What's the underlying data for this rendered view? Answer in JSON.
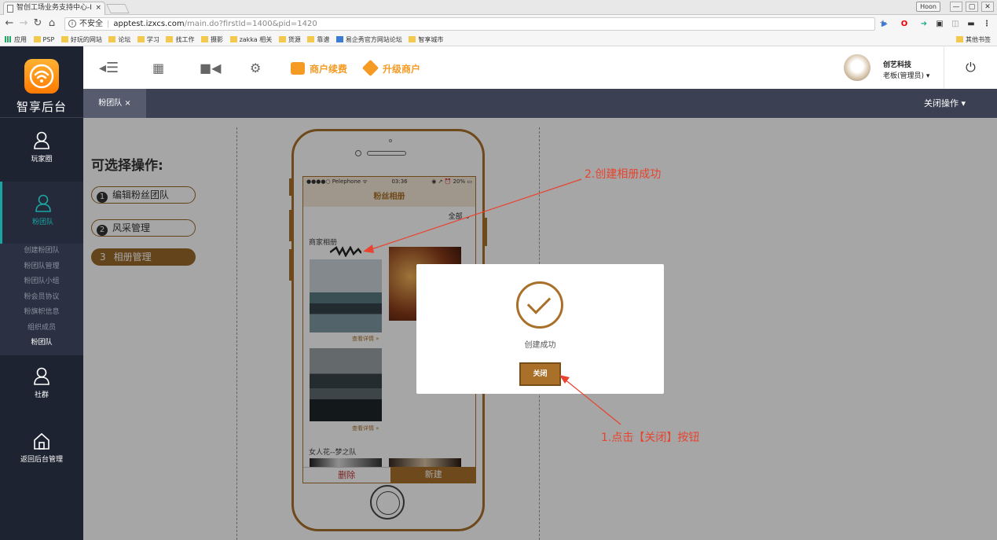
{
  "browser": {
    "tab_title": "智创工场业务支持中心-I",
    "tab_close": "×",
    "profile": "Hoon",
    "min": "—",
    "max": "▢",
    "close": "✕",
    "security": "不安全",
    "url_host": "apptest.izxcs.com",
    "url_path": "/main.do?firstId=1400&pid=1420",
    "bookmarks": [
      "应用",
      "PSP",
      "好玩的网站",
      "论坛",
      "学习",
      "找工作",
      "摄影",
      "zakka 相关",
      "货源",
      "靠谱",
      "易企秀官方网站论坛",
      "智享城市"
    ],
    "other_bookmarks": "其他书签"
  },
  "sidebar": {
    "logo_text": "智享后台",
    "items": [
      {
        "label": "玩家圈"
      },
      {
        "label": "粉团队"
      },
      {
        "label": "社群"
      },
      {
        "label": "返回后台管理"
      }
    ],
    "submenu": [
      "创建粉团队",
      "粉团队管理",
      "粉团队小组",
      "粉会员协议",
      "粉旗帜信息",
      "组织成员",
      "粉团队"
    ]
  },
  "topbar": {
    "renew": "商户续费",
    "upgrade": "升级商户",
    "user_name": "创艺科技",
    "user_role": "老板(管理员) ▾",
    "power_icon": "⏻"
  },
  "tabs": {
    "current": "粉团队 ×",
    "close_ops": "关闭操作 ▾"
  },
  "content": {
    "title": "可选择操作:",
    "ops": [
      {
        "num": "1",
        "label": "编辑粉丝团队"
      },
      {
        "num": "2",
        "label": "风采管理"
      },
      {
        "num": "3",
        "label": "相册管理"
      }
    ]
  },
  "phone": {
    "carrier": "●●●●○ Pelephone ᯤ",
    "time": "03:36",
    "battery": "◉ ↗ ⏰ 20% ▭",
    "title": "粉丝相册",
    "filter": "全部 ⌄",
    "section1": "商家相册",
    "more1": "查看详情 »",
    "more2": "查看详情 »",
    "section2": "女人花--梦之队",
    "delete": "删除",
    "new": "新建"
  },
  "modal": {
    "message": "创建成功",
    "close": "关闭"
  },
  "annotations": {
    "step2": "2.创建相册成功",
    "step1": "1.点击【关闭】按钮"
  },
  "colors": {
    "accent": "#a9702a",
    "orange": "#f59a23",
    "sidebar": "#1e2331",
    "annotation": "#e8432e"
  }
}
